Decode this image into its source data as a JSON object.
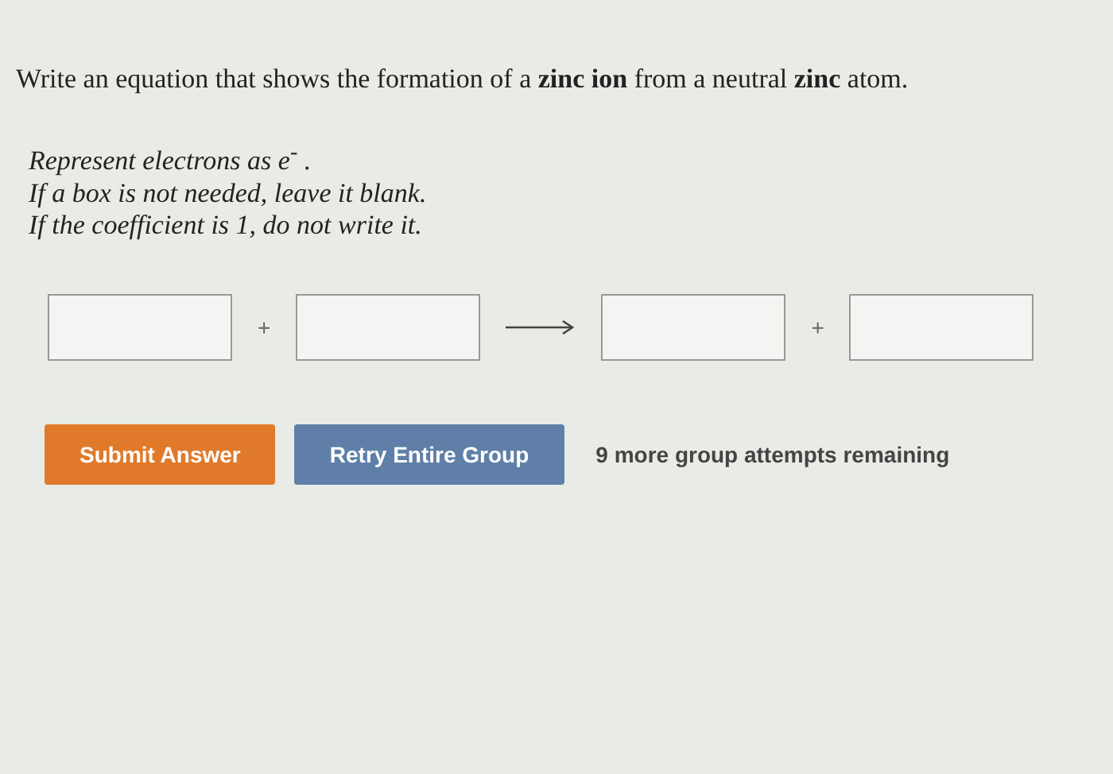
{
  "question": "Write an equation that shows the formation of a **zinc ion** from a neutral **zinc** atom.",
  "instructions": [
    "Represent electrons as e$^{-}$ .",
    "If a box is not needed, leave it blank.",
    "If the coefficient is 1, do not write it."
  ],
  "equation": [
    {
      "kind": "box"
    },
    {
      "kind": "operator",
      "text": "+"
    },
    {
      "kind": "box"
    },
    {
      "kind": "arrow"
    },
    {
      "kind": "box"
    },
    {
      "kind": "operator",
      "text": "+"
    },
    {
      "kind": "box"
    }
  ],
  "buttons": [
    {
      "label": "Submit Answer",
      "kind": "primary"
    },
    {
      "label": "Retry Entire Group",
      "kind": "secondary"
    }
  ],
  "attempts": "9 more group attempts remaining"
}
